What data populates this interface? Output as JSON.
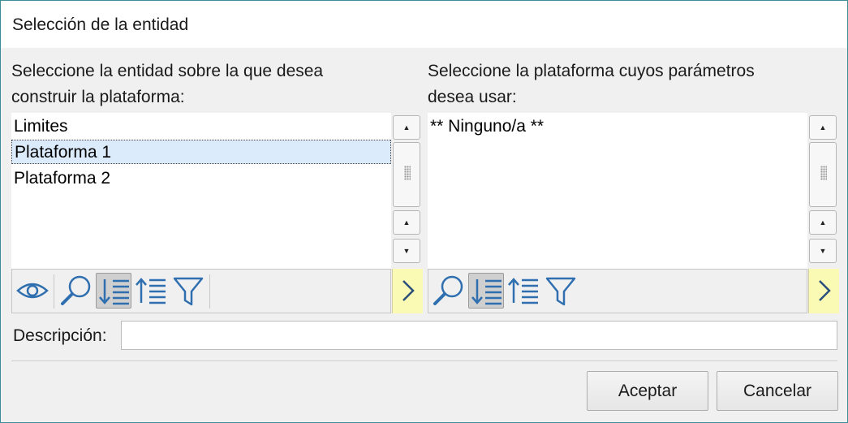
{
  "dialog": {
    "title": "Selección de la entidad"
  },
  "left": {
    "label_line1": "Seleccione la entidad sobre la que desea",
    "label_line2": "construir la plataforma:",
    "items": [
      "Limites",
      "Plataforma 1",
      "Plataforma 2"
    ],
    "selected_item": "Plataforma 1"
  },
  "right": {
    "label_line1": "Seleccione la plataforma cuyos parámetros",
    "label_line2": "desea usar:",
    "items": [
      "** Ninguno/a **"
    ]
  },
  "icons": {
    "eye": "eye-icon",
    "search": "search-icon",
    "sort_desc": "sort-descending-icon",
    "sort_asc": "sort-ascending-icon",
    "filter": "filter-icon",
    "next": "chevron-right-icon",
    "scroll_up": "triangle-up",
    "scroll_down": "triangle-down"
  },
  "description": {
    "label": "Descripción:",
    "value": ""
  },
  "buttons": {
    "accept": "Aceptar",
    "cancel": "Cancelar"
  },
  "colors": {
    "window_border": "#3c8d99",
    "icon_blue": "#2f6fb0",
    "selection_bg": "#dcebfb",
    "next_button_bg": "#fafab4"
  }
}
